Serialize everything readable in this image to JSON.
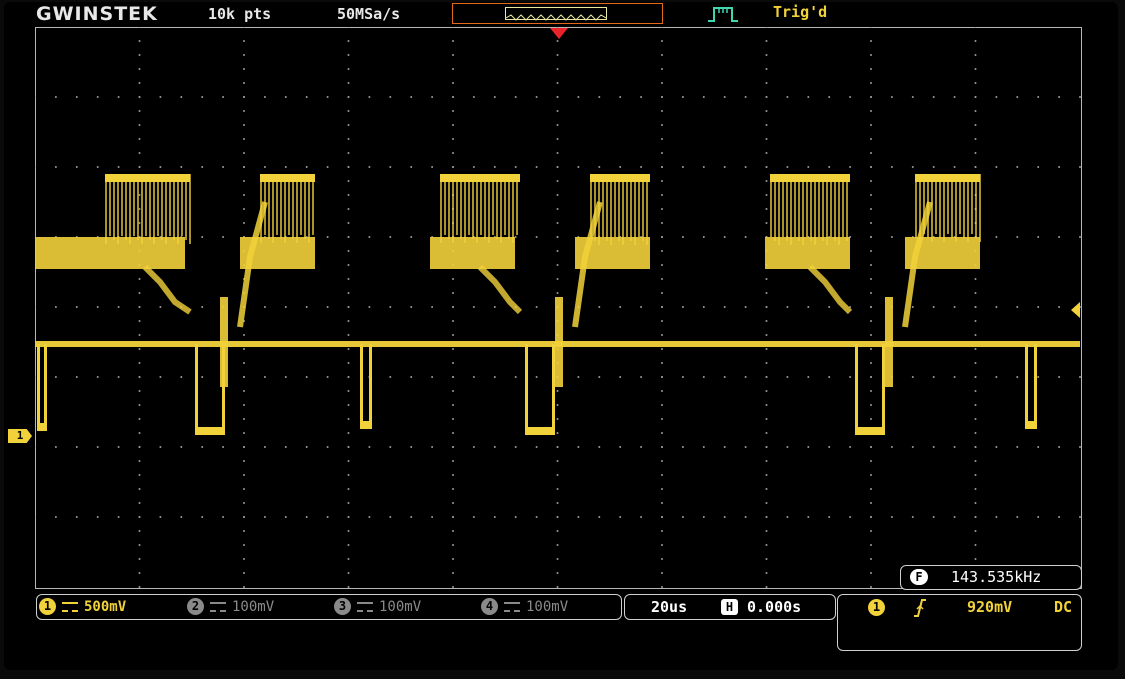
{
  "header": {
    "brand": "GWINSTEK",
    "record_length": "10k pts",
    "sample_rate": "50MSa/s",
    "trigger_status": "Trig'd"
  },
  "channels": [
    {
      "id": "1",
      "scale": "500mV",
      "color": "#f2d23a",
      "enabled": true
    },
    {
      "id": "2",
      "scale": "100mV",
      "color": "#8a8a8a",
      "enabled": false
    },
    {
      "id": "3",
      "scale": "100mV",
      "color": "#8a8a8a",
      "enabled": false
    },
    {
      "id": "4",
      "scale": "100mV",
      "color": "#8a8a8a",
      "enabled": false
    }
  ],
  "horizontal": {
    "timebase": "20us",
    "position": "0.000s"
  },
  "trigger": {
    "source": "1",
    "slope": "rising-edge-icon",
    "level": "920mV",
    "coupling": "DC"
  },
  "frequency": {
    "value": "143.535kHz"
  },
  "ch1_marker_label": "1",
  "icons": {
    "freq": "F",
    "horizontal": "H"
  },
  "colors": {
    "trace": "#f2d23a",
    "grid": "#b8b8b8",
    "trigger_marker": "#e8242a",
    "memory_bar": "#e06a1a"
  }
}
